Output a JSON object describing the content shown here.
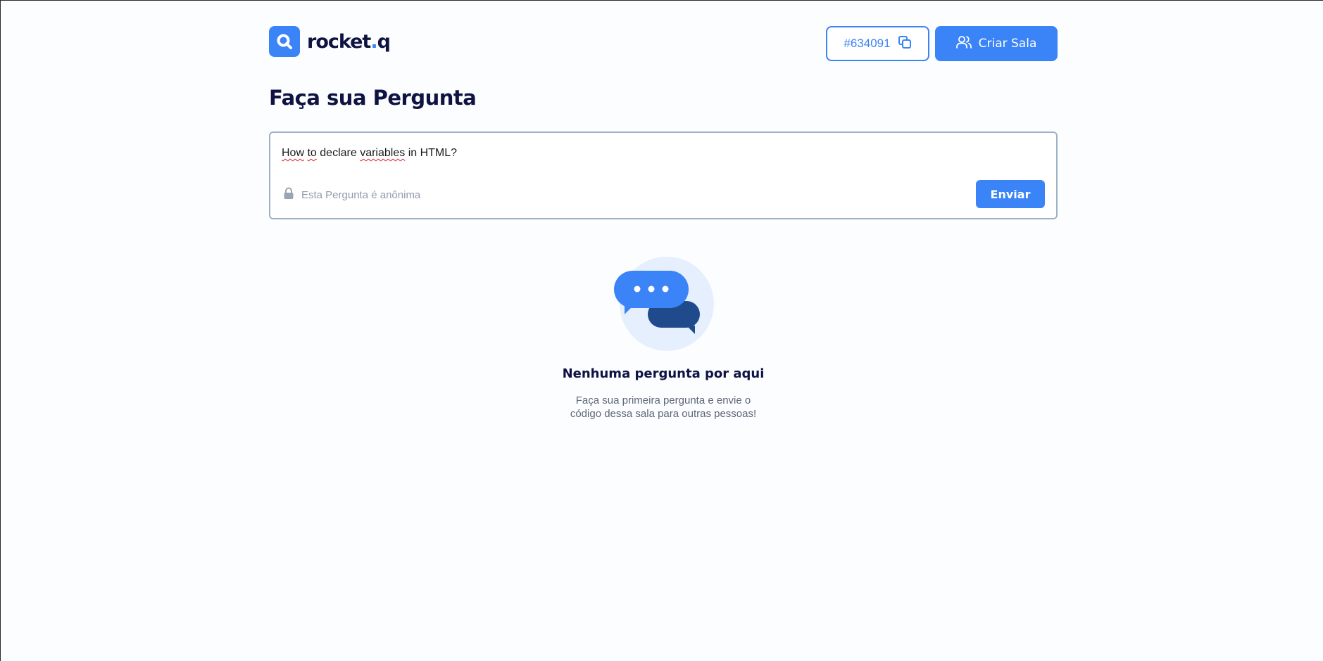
{
  "header": {
    "logo_text": "rocket",
    "logo_dot": ".",
    "logo_suffix": "q",
    "room_code": "#634091",
    "create_room_label": "Criar Sala"
  },
  "page": {
    "title": "Faça sua Pergunta"
  },
  "question_form": {
    "input_words": [
      "How",
      "to",
      "declare",
      "variables",
      "in HTML?"
    ],
    "anonymous_label": "Esta Pergunta é anônima",
    "send_label": "Enviar"
  },
  "empty_state": {
    "title": "Nenhuma pergunta por aqui",
    "text_line1": "Faça sua primeira pergunta e envie o",
    "text_line2": "código dessa sala para outras pessoas!"
  },
  "colors": {
    "accent": "#3a84f7",
    "dark": "#0f1342",
    "bubble_dark": "#1f4a8c"
  },
  "icons": [
    "rocketq-logo-icon",
    "copy-icon",
    "users-icon",
    "lock-icon",
    "chat-bubbles-illustration"
  ]
}
